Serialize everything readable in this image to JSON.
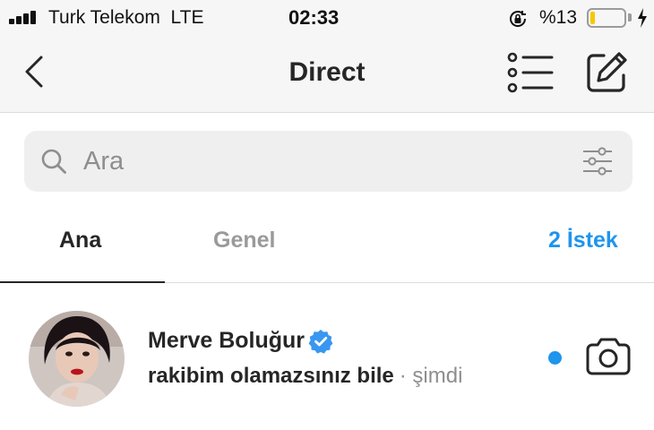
{
  "status_bar": {
    "carrier": "Turk Telekom",
    "network": "LTE",
    "time": "02:33",
    "battery_percent": "%13",
    "battery_level": 0.13,
    "icons": [
      "signal-bars-icon",
      "orientation-lock-icon",
      "battery-icon",
      "charging-bolt-icon"
    ]
  },
  "nav": {
    "title": "Direct",
    "icons": [
      "back-chevron-icon",
      "list-icon",
      "compose-icon"
    ]
  },
  "search": {
    "placeholder": "Ara",
    "icons": [
      "search-icon",
      "filter-icon"
    ]
  },
  "tabs": [
    {
      "label": "Ana",
      "active": true
    },
    {
      "label": "Genel",
      "active": false
    },
    {
      "label": "2 İstek",
      "active": false
    }
  ],
  "conversations": [
    {
      "name": "Merve Boluğur",
      "verified": true,
      "message": "rakibim olamazsınız bile",
      "time": "· şimdi",
      "unread": true,
      "icons": [
        "avatar",
        "verified-badge-icon",
        "camera-icon"
      ]
    }
  ],
  "colors": {
    "accent": "#1f95ec",
    "battery": "#f7c800",
    "header_bg": "#f6f6f6",
    "search_bg": "#efefef"
  }
}
